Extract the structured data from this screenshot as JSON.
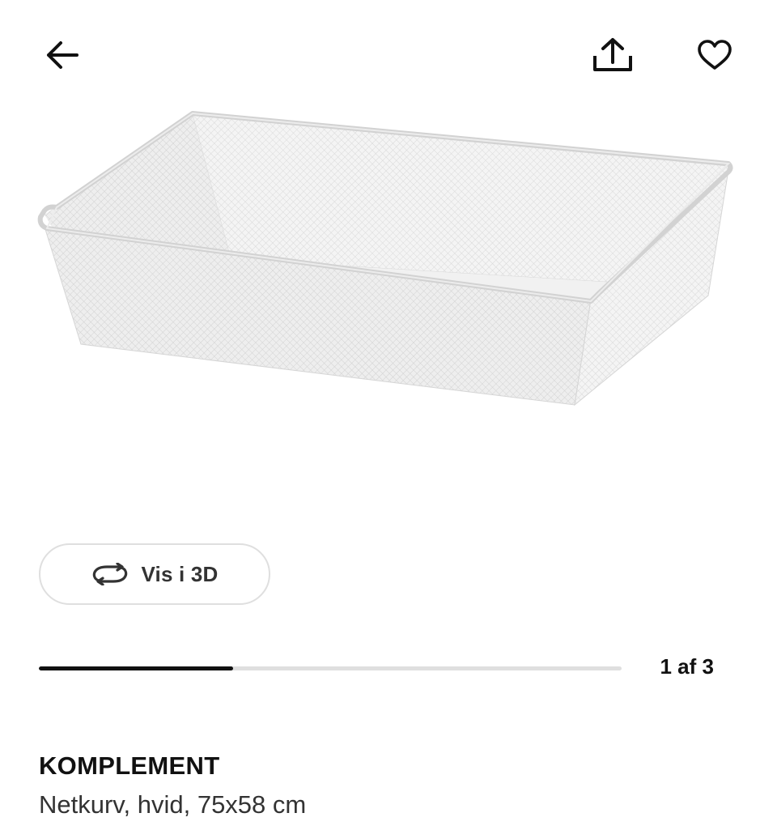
{
  "header": {
    "back_icon": "arrow-left-icon",
    "share_icon": "share-upload-icon",
    "favorite_icon": "heart-outline-icon"
  },
  "gallery": {
    "image_subject": "product-photo-wire-basket",
    "view_3d_label": "Vis i 3D",
    "view_3d_icon": "rotate-3d-icon",
    "current_index": 1,
    "total": 3,
    "counter_text": "1 af 3",
    "progress_fraction": 0.3333
  },
  "product": {
    "name": "KOMPLEMENT",
    "description": "Netkurv, hvid, 75x58 cm"
  },
  "colors": {
    "text_primary": "#111111",
    "text_secondary": "#333333",
    "track": "#dfdfdf",
    "border": "#dfdfdf"
  }
}
